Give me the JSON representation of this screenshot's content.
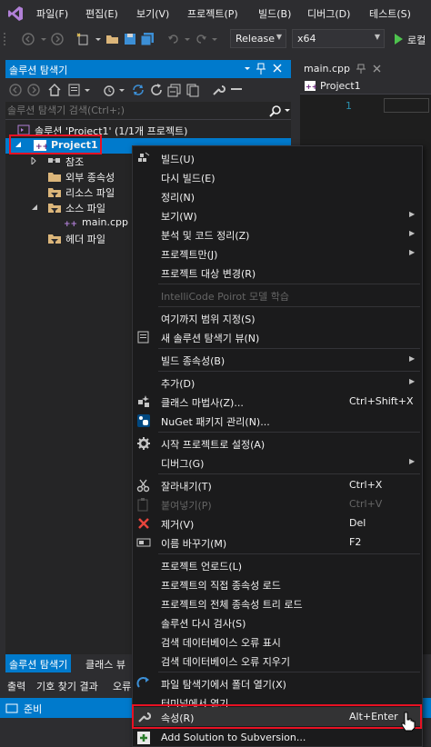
{
  "menubar": {
    "items": [
      {
        "label": "파일(F)"
      },
      {
        "label": "편집(E)"
      },
      {
        "label": "보기(V)"
      },
      {
        "label": "프로젝트(P)"
      },
      {
        "label": "빌드(B)"
      },
      {
        "label": "디버그(D)"
      },
      {
        "label": "테스트(S)"
      }
    ]
  },
  "toolbar": {
    "config": "Release",
    "platform": "x64",
    "run_label": "로컬"
  },
  "solution_explorer": {
    "title": "솔루션 탐색기",
    "pin_icon": "pin-icon",
    "close_icon": "close-icon",
    "search_placeholder": "솔루션 탐색기 검색(Ctrl+;)",
    "tree": {
      "solution": "솔루션 'Project1' (1/1개 프로젝트)",
      "project": "Project1",
      "references": "참조",
      "external_deps": "외부 종속성",
      "resource_files": "리소스 파일",
      "source_files": "소스 파일",
      "main_cpp": "main.cpp",
      "header_files": "헤더 파일"
    },
    "tabs": [
      "솔루션 탐색기",
      "클래스 뷰"
    ]
  },
  "output_tabs": [
    "출력",
    "기호 찾기 결과",
    "오류"
  ],
  "statusbar": {
    "text": "준비"
  },
  "editor": {
    "tab": "main.cpp",
    "nav": "Project1",
    "line_number": "1"
  },
  "context_menu": {
    "items": [
      {
        "label": "빌드(U)"
      },
      {
        "label": "다시 빌드(E)"
      },
      {
        "label": "정리(N)"
      },
      {
        "label": "보기(W)"
      },
      {
        "label": "분석 및 코드 정리(Z)"
      },
      {
        "label": "프로젝트만(J)"
      },
      {
        "label": "프로젝트 대상 변경(R)"
      },
      {
        "label": "IntelliCode Poirot 모델 학습"
      },
      {
        "label": "여기까지 범위 지정(S)"
      },
      {
        "label": "새 솔루션 탐색기 뷰(N)"
      },
      {
        "label": "빌드 종속성(B)"
      },
      {
        "label": "추가(D)"
      },
      {
        "label": "클래스 마법사(Z)...",
        "shortcut": "Ctrl+Shift+X"
      },
      {
        "label": "NuGet 패키지 관리(N)..."
      },
      {
        "label": "시작 프로젝트로 설정(A)"
      },
      {
        "label": "디버그(G)"
      },
      {
        "label": "잘라내기(T)",
        "shortcut": "Ctrl+X"
      },
      {
        "label": "붙여넣기(P)",
        "shortcut": "Ctrl+V"
      },
      {
        "label": "제거(V)",
        "shortcut": "Del"
      },
      {
        "label": "이름 바꾸기(M)",
        "shortcut": "F2"
      },
      {
        "label": "프로젝트 언로드(L)"
      },
      {
        "label": "프로젝트의 직접 종속성 로드"
      },
      {
        "label": "프로젝트의 전체 종속성 트리 로드"
      },
      {
        "label": "솔루션 다시 검사(S)"
      },
      {
        "label": "검색 데이터베이스 오류 표시"
      },
      {
        "label": "검색 데이터베이스 오류 지우기"
      },
      {
        "label": "파일 탐색기에서 폴더 열기(X)"
      },
      {
        "label": "터미널에서 열기"
      },
      {
        "label": "속성(R)",
        "shortcut": "Alt+Enter"
      },
      {
        "label": "Add Solution to Subversion..."
      }
    ]
  },
  "colors": {
    "accent": "#007acc",
    "highlight_box": "#e81123",
    "menu_bg": "#1b1b1c",
    "panel_bg": "#252526"
  }
}
